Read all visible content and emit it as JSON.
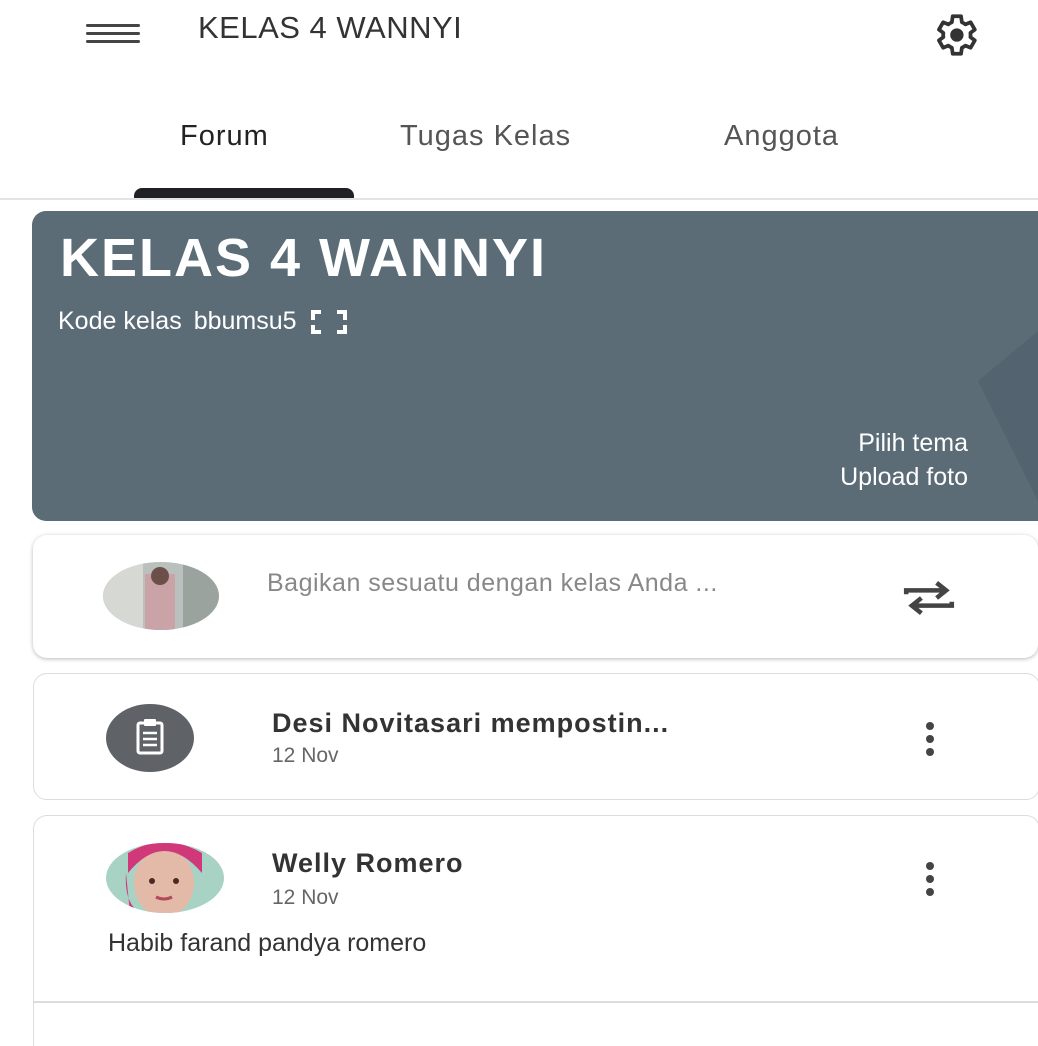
{
  "app_bar": {
    "title": "KELAS 4 WANNYI",
    "menu_icon": "hamburger-menu-icon",
    "settings_icon": "gear-icon"
  },
  "tabs": [
    {
      "label": "Forum",
      "active": true
    },
    {
      "label": "Tugas Kelas",
      "active": false
    },
    {
      "label": "Anggota",
      "active": false
    }
  ],
  "banner": {
    "title": "KELAS 4 WANNYI",
    "class_code_label": "Kode kelas",
    "class_code": "bbumsu5",
    "fullscreen_icon": "fullscreen-icon",
    "choose_theme": "Pilih tema",
    "upload_photo": "Upload foto",
    "color": "#5b6c77"
  },
  "share_box": {
    "placeholder": "Bagikan sesuatu dengan kelas Anda ...",
    "repost_icon": "repeat-arrows-icon"
  },
  "posts": [
    {
      "type": "assignment",
      "icon": "assignment-icon",
      "title": "Desi Novitasari mempostin...",
      "date": "12 Nov"
    },
    {
      "type": "announcement",
      "author": "Welly Romero",
      "date": "12 Nov",
      "body": "Habib farand pandya romero"
    }
  ],
  "colors": {
    "banner": "#5b6c77",
    "tab_indicator": "#202124",
    "icon_circle": "#5f6368"
  }
}
